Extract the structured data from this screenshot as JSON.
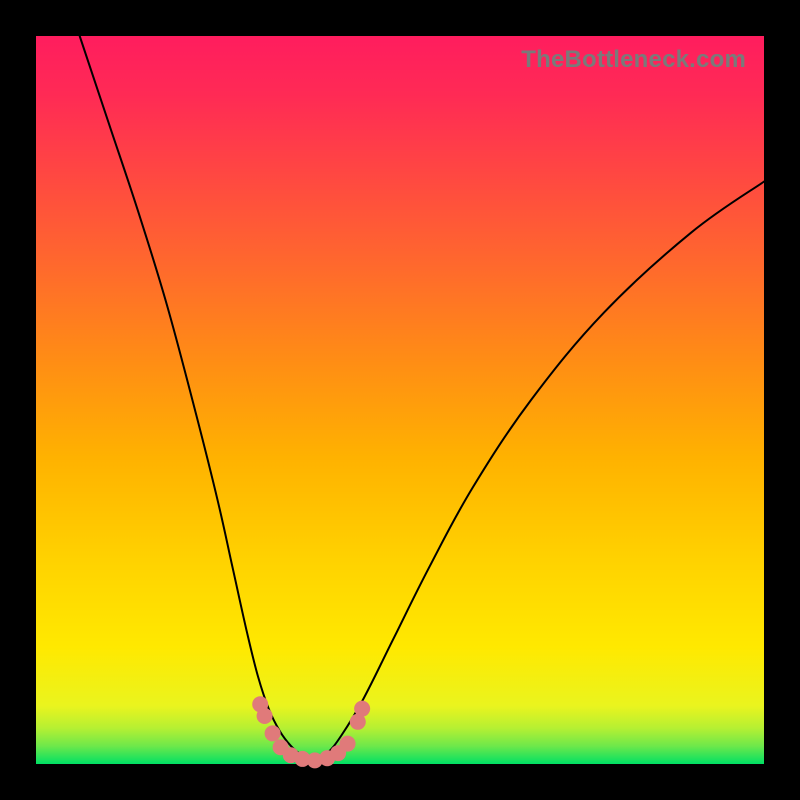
{
  "watermark": "TheBottleneck.com",
  "chart_data": {
    "type": "line",
    "title": "",
    "xlabel": "",
    "ylabel": "",
    "xlim": [
      0,
      100
    ],
    "ylim": [
      0,
      100
    ],
    "grid": false,
    "background": "vertical-gradient-red-to-green",
    "legend": false,
    "series": [
      {
        "name": "left-branch",
        "x": [
          6,
          10,
          14,
          18,
          22,
          25,
          27,
          29,
          30.5,
          32,
          33.5,
          35,
          36.5,
          38
        ],
        "y": [
          100,
          88,
          76,
          63,
          48,
          36,
          27,
          18,
          12,
          7.5,
          4.5,
          2.5,
          1.2,
          0.5
        ]
      },
      {
        "name": "right-branch",
        "x": [
          38,
          40,
          42,
          45,
          49,
          54,
          60,
          68,
          78,
          90,
          100
        ],
        "y": [
          0.5,
          1.5,
          4,
          9,
          17,
          27,
          38,
          50,
          62,
          73,
          80
        ]
      }
    ],
    "markers": {
      "name": "bottom-dots",
      "points": [
        {
          "x": 30.8,
          "y": 8.2
        },
        {
          "x": 31.4,
          "y": 6.6
        },
        {
          "x": 32.5,
          "y": 4.2
        },
        {
          "x": 33.6,
          "y": 2.3
        },
        {
          "x": 35.0,
          "y": 1.2
        },
        {
          "x": 36.6,
          "y": 0.7
        },
        {
          "x": 38.3,
          "y": 0.5
        },
        {
          "x": 40.0,
          "y": 0.8
        },
        {
          "x": 41.5,
          "y": 1.5
        },
        {
          "x": 42.8,
          "y": 2.8
        },
        {
          "x": 44.2,
          "y": 5.8
        },
        {
          "x": 44.8,
          "y": 7.6
        }
      ],
      "radius_pct": 1.1
    }
  }
}
